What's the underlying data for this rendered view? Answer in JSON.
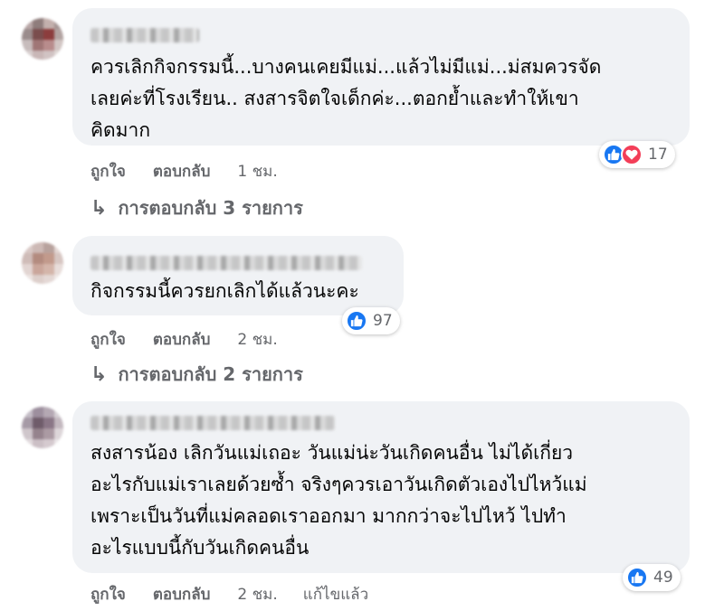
{
  "comments": [
    {
      "text": "ควรเลิกกิจกรรมนี้...บางคนเคยมีแม่...แล้วไม่มีแม่...ม่สมควรจัด\nเลยค่ะที่โรงเรียน.. สงสารจิตใจเด็กค่ะ...ตอกย้ำและทำให้เขา\nคิดมาก",
      "reactions": [
        "like-icon",
        "love-icon"
      ],
      "reaction_count": "17",
      "like_label": "ถูกใจ",
      "reply_label": "ตอบกลับ",
      "time": "1 ชม.",
      "replies_label": "การตอบกลับ 3 รายการ"
    },
    {
      "text": "กิจกรรมนี้ควรยกเลิกได้แล้วนะคะ",
      "reactions": [
        "like-icon"
      ],
      "reaction_count": "97",
      "like_label": "ถูกใจ",
      "reply_label": "ตอบกลับ",
      "time": "2 ชม.",
      "replies_label": "การตอบกลับ 2 รายการ"
    },
    {
      "text": "สงสารน้อง เลิกวันแม่เถอะ วันแม่น่ะวันเกิดคนอื่น ไม่ได้เกี่ยว\nอะไรกับแม่เราเลยด้วยซ้ำ จริงๆควรเอาวันเกิดตัวเองไปไหว้แม่\nเพราะเป็นวันที่แม่คลอดเราออกมา มากกว่าจะไปไหว้ ไปทำ\nอะไรแบบนี้กับวันเกิดคนอื่น",
      "reactions": [
        "like-icon"
      ],
      "reaction_count": "49",
      "like_label": "ถูกใจ",
      "reply_label": "ตอบกลับ",
      "time": "2 ชม.",
      "edited_label": "แก้ไขแล้ว"
    }
  ],
  "colors": {
    "bubble": "#f0f2f5",
    "meta_text": "#65676b",
    "like_blue": "#1877f2",
    "love_red": "#f33e58"
  }
}
